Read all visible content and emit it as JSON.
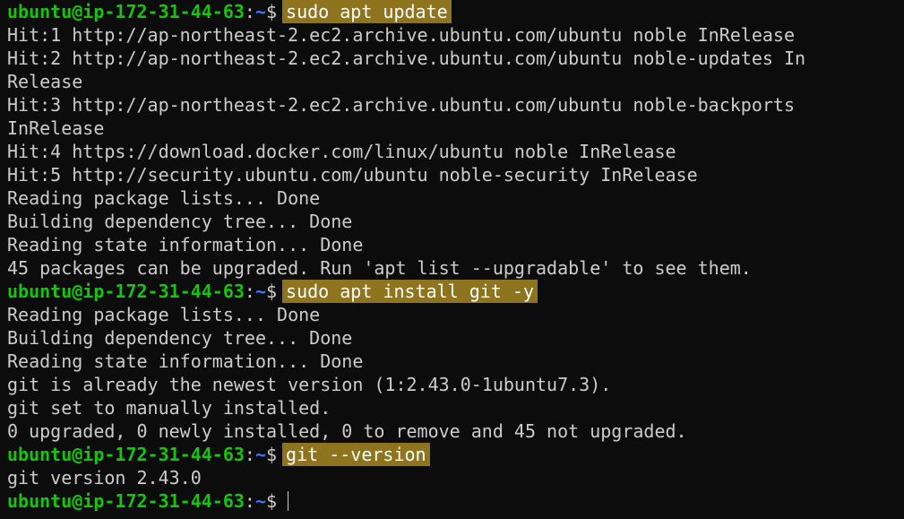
{
  "terminal": {
    "prompt": {
      "user_host": "ubuntu@ip-172-31-44-63",
      "colon": ":",
      "path": "~",
      "dollar": "$"
    },
    "commands": [
      "sudo apt update",
      "sudo apt install git -y",
      "git --version"
    ],
    "output_block_1": [
      "Hit:1 http://ap-northeast-2.ec2.archive.ubuntu.com/ubuntu noble InRelease",
      "Hit:2 http://ap-northeast-2.ec2.archive.ubuntu.com/ubuntu noble-updates In",
      "Release",
      "Hit:3 http://ap-northeast-2.ec2.archive.ubuntu.com/ubuntu noble-backports",
      "InRelease",
      "Hit:4 https://download.docker.com/linux/ubuntu noble InRelease",
      "Hit:5 http://security.ubuntu.com/ubuntu noble-security InRelease",
      "Reading package lists... Done",
      "Building dependency tree... Done",
      "Reading state information... Done",
      "45 packages can be upgraded. Run 'apt list --upgradable' to see them."
    ],
    "output_block_2": [
      "Reading package lists... Done",
      "Building dependency tree... Done",
      "Reading state information... Done",
      "git is already the newest version (1:2.43.0-1ubuntu7.3).",
      "git set to manually installed.",
      "0 upgraded, 0 newly installed, 0 to remove and 45 not upgraded."
    ],
    "output_block_3": [
      "git version 2.43.0"
    ],
    "colors": {
      "background": "#0c0c0c",
      "text": "#cccccc",
      "user_host": "#16c60c",
      "path": "#3b78ff",
      "command_highlight": "#8f7420"
    }
  }
}
